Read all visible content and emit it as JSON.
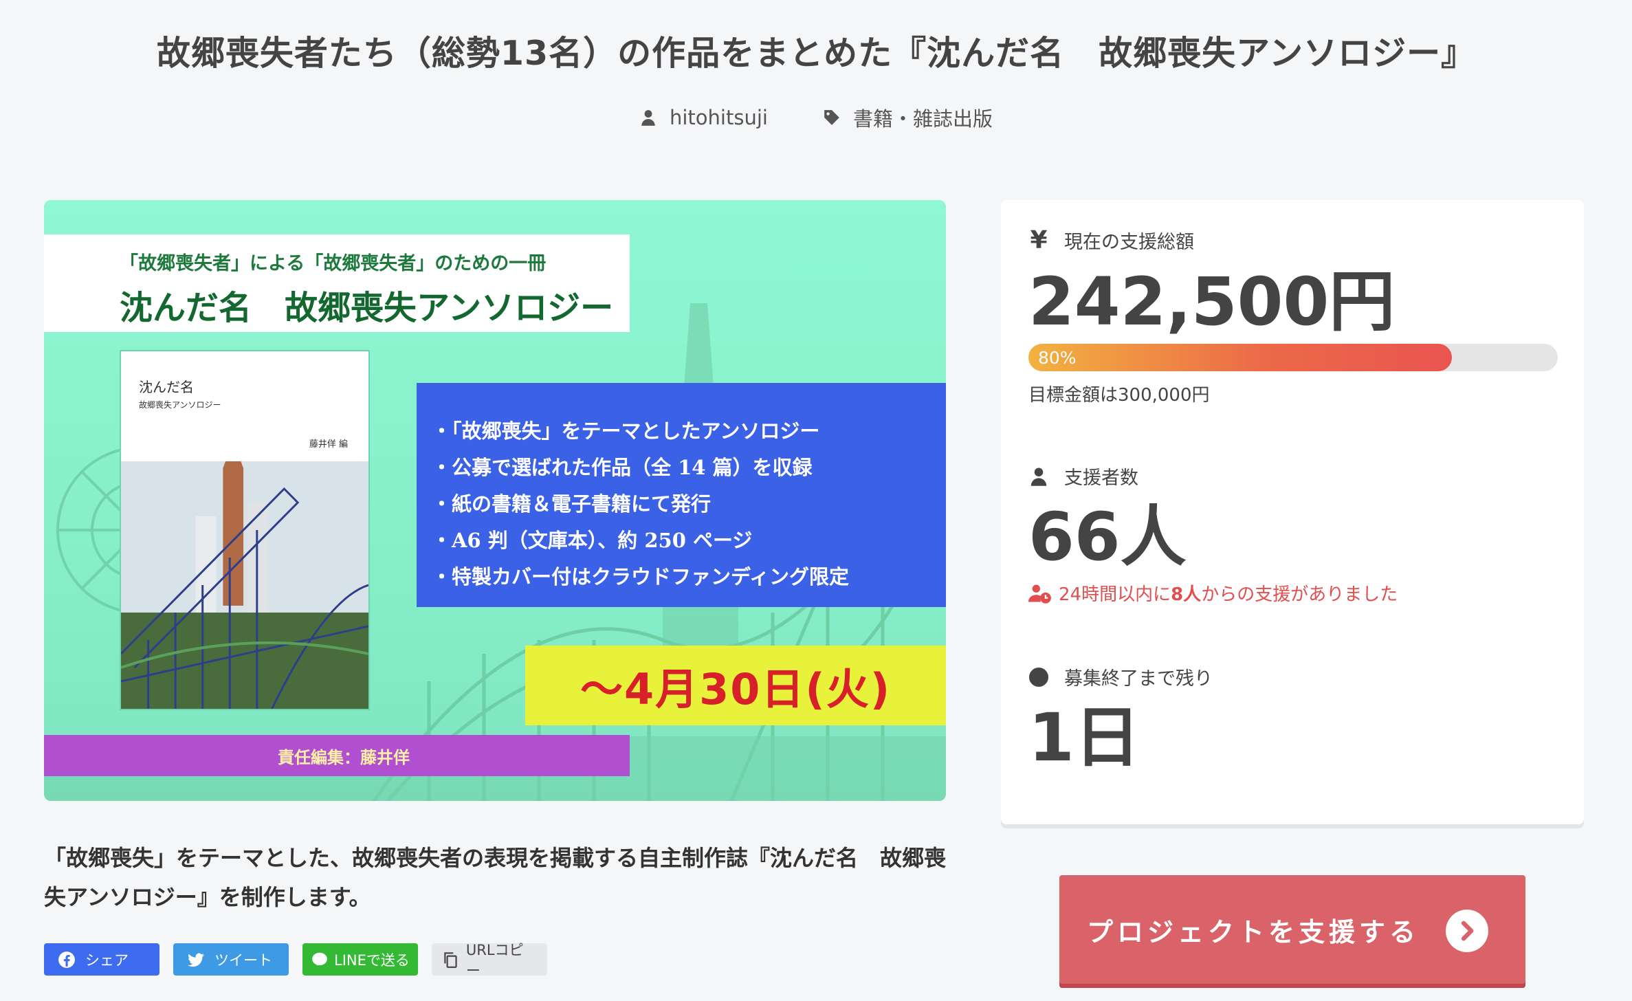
{
  "project": {
    "title": "故郷喪失者たち（総勢13名）の作品をまとめた『沈んだ名　故郷喪失アンソロジー』",
    "author": "hitohitsuji",
    "category": "書籍・雑誌出版"
  },
  "hero": {
    "banner_sub": "「故郷喪失者」による「故郷喪失者」のための一冊",
    "banner_main": "沈んだ名　故郷喪失アンソロジー",
    "book_title": "沈んだ名",
    "book_subtitle": "故郷喪失アンソロジー",
    "book_editor": "藤井佯 編",
    "features": [
      "・「故郷喪失」をテーマとしたアンソロジー",
      "・公募で選ばれた作品（全 14 篇）を収録",
      "・紙の書籍＆電子書籍にて発行",
      "・A6 判（文庫本）、約 250 ページ",
      "・特製カバー付はクラウドファンディング限定"
    ],
    "deadline": "～4月30日(火)",
    "editor": "責任編集：藤井佯"
  },
  "lead_text": "「故郷喪失」をテーマとした、故郷喪失者の表現を掲載する自主制作誌『沈んだ名　故郷喪失アンソロジー』を制作します。",
  "share": {
    "facebook": "シェア",
    "twitter": "ツイート",
    "line": "LINEで送る",
    "url": "URLコピー"
  },
  "stats": {
    "funded_label": "現在の支援総額",
    "funded_value": "242,500円",
    "progress_percent": 80,
    "progress_label": "80%",
    "goal_text": "目標金額は300,000円",
    "backers_label": "支援者数",
    "backers_value": "66人",
    "recent_prefix": "24時間以内に",
    "recent_count": "8人",
    "recent_suffix": "からの支援がありました",
    "remaining_label": "募集終了まで残り",
    "remaining_value": "1日"
  },
  "cta": {
    "label": "プロジェクトを支援する"
  },
  "colors": {
    "accent": "#d96369",
    "progress_start": "#f2b240",
    "progress_end": "#e95550",
    "alert": "#e24e4e"
  },
  "icons": [
    "user-icon",
    "tag-icon",
    "yen-icon",
    "person-icon",
    "users-clock-icon",
    "clock-icon",
    "facebook-icon",
    "twitter-icon",
    "line-icon",
    "copy-icon",
    "chevron-right-icon"
  ]
}
